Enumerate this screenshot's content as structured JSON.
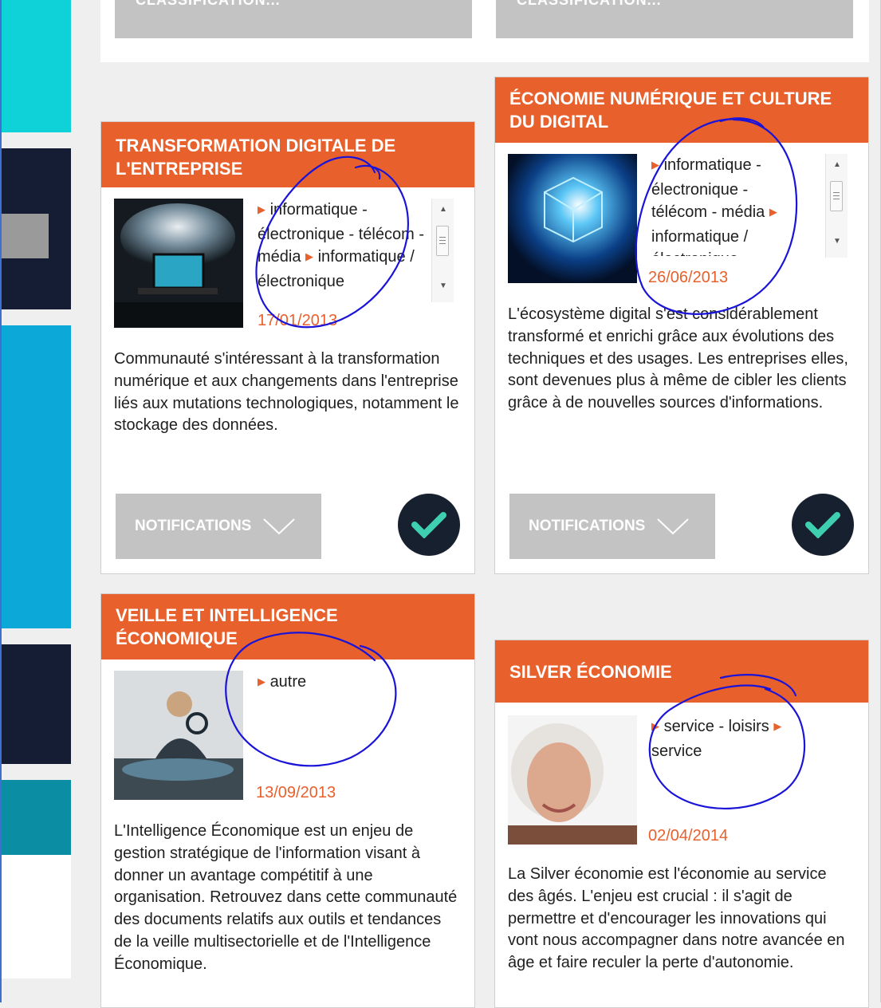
{
  "colors": {
    "accent": "#e8602c",
    "button_gray": "#c3c3c3",
    "check_bg": "#17202e",
    "check_mark": "#3ecfb0",
    "annotation_ink": "#1a14d8"
  },
  "top_buttons": [
    {
      "label": "CLASSIFICATION..."
    },
    {
      "label": "CLASSIFICATION..."
    }
  ],
  "cards": [
    {
      "title": "TRANSFORMATION DIGITALE DE L'ENTREPRISE",
      "image_icon": "digital-transformation-image",
      "tags_text": "informatique - électronique - télécom - média",
      "tags_text2": "informatique / électronique",
      "date": "17/01/2013",
      "description": "Communauté s'intéressant à la transformation numérique et aux changements dans l'entreprise liés aux mutations technologiques, notamment le stockage des données.",
      "notifications_label": "NOTIFICATIONS"
    },
    {
      "title": "ÉCONOMIE NUMÉRIQUE ET CULTURE DU DIGITAL",
      "image_icon": "digital-cube-image",
      "tags_text": "informatique - électronique - télécom - média",
      "tags_text2": "informatique / électronique",
      "date": "26/06/2013",
      "description": "L'écosystème digital s'est considérablement transformé et enrichi grâce aux évolutions des techniques et des usages. Les entreprises elles, sont devenues plus à même de cibler les clients grâce à de nouvelles sources d'informations.",
      "notifications_label": "NOTIFICATIONS"
    },
    {
      "title": "VEILLE ET INTELLIGENCE ÉCONOMIQUE",
      "image_icon": "magnifier-businessman-image",
      "tags_text": "autre",
      "date": "13/09/2013",
      "description": "L'Intelligence Économique est un enjeu de gestion stratégique de l'information visant à donner un avantage compétitif à une organisation. Retrouvez dans cette communauté des documents relatifs aux outils et tendances de la veille multisectorielle et de l'Intelligence Économique."
    },
    {
      "title": "SILVER ÉCONOMIE",
      "image_icon": "senior-woman-image",
      "tags_text": "service - loisirs",
      "tags_text2": "service",
      "date": "02/04/2014",
      "description": "La Silver économie est l'économie au service des âgés. L'enjeu est crucial : il s'agit de permettre et d'encourager les innovations qui vont nous accompagner dans notre avancée en âge et faire reculer la perte d'autonomie."
    }
  ]
}
